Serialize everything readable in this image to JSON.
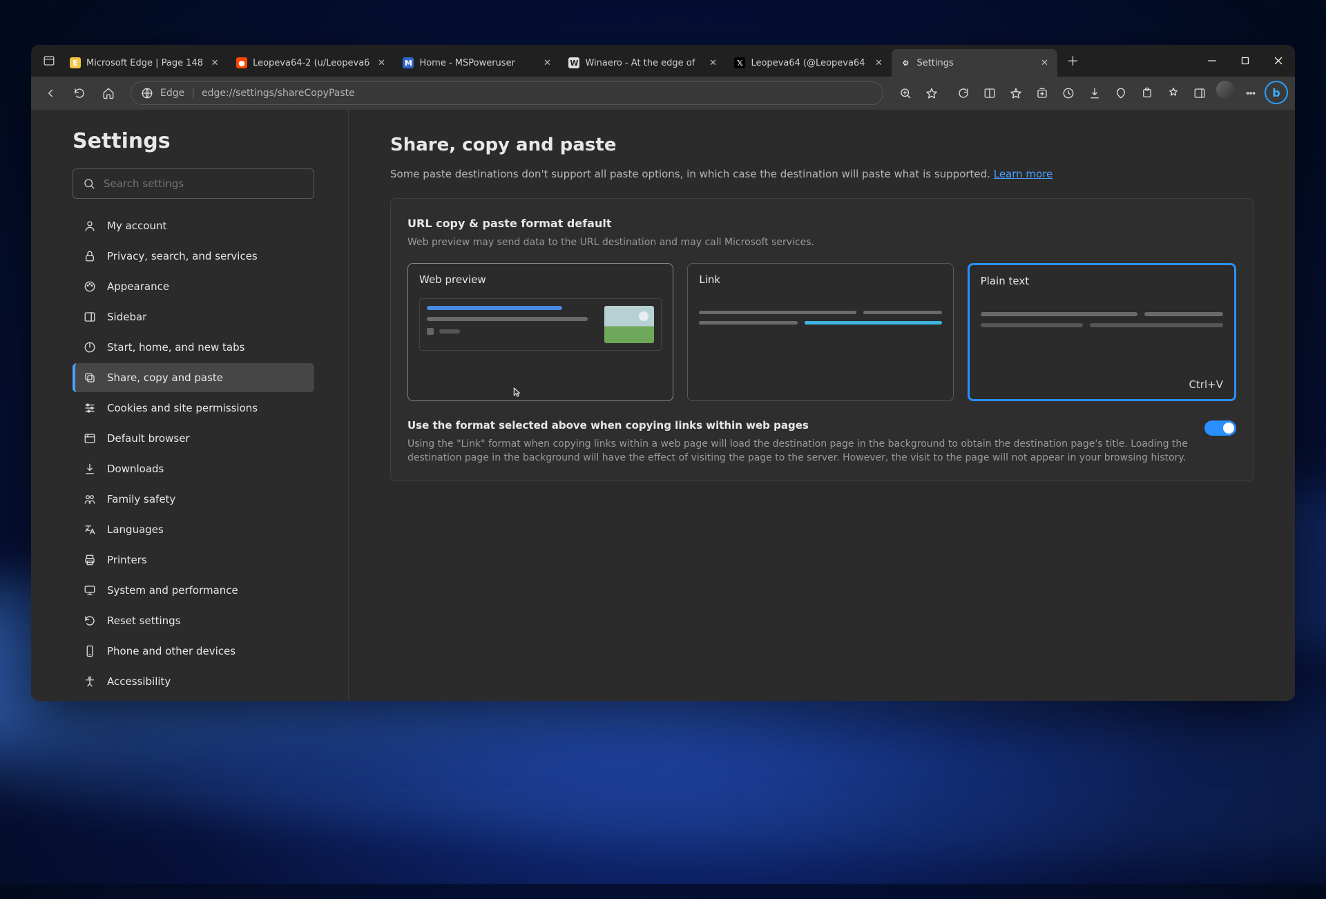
{
  "tabs": [
    {
      "label": "Microsoft Edge | Page 148",
      "favicon_bg": "#f2c744",
      "favicon_text": "E"
    },
    {
      "label": "Leopeva64-2 (u/Leopeva6",
      "favicon_bg": "#ff4500",
      "favicon_text": "●"
    },
    {
      "label": "Home - MSPoweruser",
      "favicon_bg": "#3366cc",
      "favicon_text": "M"
    },
    {
      "label": "Winaero - At the edge of",
      "favicon_bg": "#ddd",
      "favicon_text": "W",
      "favicon_fg": "#222"
    },
    {
      "label": "Leopeva64 (@Leopeva64",
      "favicon_bg": "#000",
      "favicon_text": "𝕏"
    },
    {
      "label": "Settings",
      "favicon_bg": "transparent",
      "favicon_text": "⚙",
      "active": true
    }
  ],
  "addr": {
    "identity": "Edge",
    "url": "edge://settings/shareCopyPaste"
  },
  "sidebar": {
    "title": "Settings",
    "search_placeholder": "Search settings",
    "items": [
      {
        "label": "My account",
        "icon": "user"
      },
      {
        "label": "Privacy, search, and services",
        "icon": "lock"
      },
      {
        "label": "Appearance",
        "icon": "paint"
      },
      {
        "label": "Sidebar",
        "icon": "panel"
      },
      {
        "label": "Start, home, and new tabs",
        "icon": "power"
      },
      {
        "label": "Share, copy and paste",
        "icon": "copy",
        "active": true
      },
      {
        "label": "Cookies and site permissions",
        "icon": "sliders"
      },
      {
        "label": "Default browser",
        "icon": "browser"
      },
      {
        "label": "Downloads",
        "icon": "download"
      },
      {
        "label": "Family safety",
        "icon": "family"
      },
      {
        "label": "Languages",
        "icon": "lang"
      },
      {
        "label": "Printers",
        "icon": "printer"
      },
      {
        "label": "System and performance",
        "icon": "system"
      },
      {
        "label": "Reset settings",
        "icon": "reset"
      },
      {
        "label": "Phone and other devices",
        "icon": "phone"
      },
      {
        "label": "Accessibility",
        "icon": "access"
      }
    ]
  },
  "main": {
    "title": "Share, copy and paste",
    "desc": "Some paste destinations don't support all paste options, in which case the destination will paste what is supported.",
    "learn_more": "Learn more",
    "panel_title": "URL copy & paste format default",
    "panel_sub": "Web preview may send data to the URL destination and may call Microsoft services.",
    "cards": [
      {
        "title": "Web preview"
      },
      {
        "title": "Link"
      },
      {
        "title": "Plain text",
        "shortcut": "Ctrl+V",
        "selected": true
      }
    ],
    "toggle_title": "Use the format selected above when copying links within web pages",
    "toggle_desc": "Using the \"Link\" format when copying links within a web page will load the destination page in the background to obtain the destination page's title. Loading the destination page in the background will have the effect of visiting the page to the server. However, the visit to the page will not appear in your browsing history.",
    "toggle_on": true
  }
}
